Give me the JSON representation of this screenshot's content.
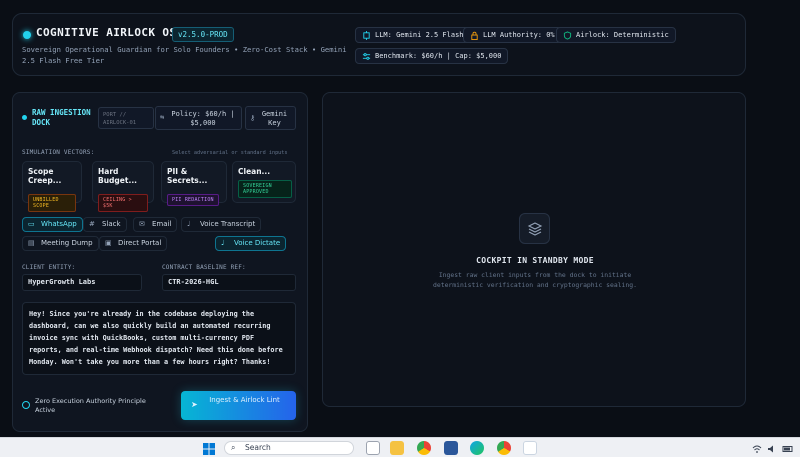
{
  "header": {
    "title": "COGNITIVE AIRLOCK OS",
    "version": "v2.5.0-PROD",
    "subtitle": "Sovereign Operational Guardian for Solo Founders • Zero-Cost Stack • Gemini 2.5 Flash Free Tier",
    "pills": {
      "llm": "LLM: Gemini 2.5 Flash",
      "authority": "LLM Authority: 0%",
      "airlock": "Airlock: Deterministic",
      "benchmark": "Benchmark: $60/h | Cap: $5,000"
    }
  },
  "dock": {
    "title": "RAW INGESTION DOCK",
    "port": "PORT // AIRLOCK-01",
    "policy": "Policy: $60/h | $5,000",
    "gemini_key": "Gemini Key",
    "vectors_label": "SIMULATION VECTORS:",
    "vectors_hint": "Select adversarial or standard inputs",
    "vectors": [
      {
        "title": "Scope Creep...",
        "tag": "UNBILLED SCOPE",
        "color": "#f59e0b"
      },
      {
        "title": "Hard Budget...",
        "tag": "CEILING > $5K",
        "color": "#ef4444"
      },
      {
        "title": "PII & Secrets...",
        "tag": "PII REDACTION",
        "color": "#a855f7"
      },
      {
        "title": "Clean...",
        "tag": "SOVEREIGN APPROVED",
        "color": "#10b981"
      }
    ],
    "channels": {
      "whatsapp": "WhatsApp",
      "slack": "Slack",
      "email": "Email",
      "voice_transcript": "Voice Transcript",
      "meeting_dump": "Meeting Dump",
      "direct_portal": "Direct Portal",
      "voice_dictate": "Voice Dictate"
    },
    "client_label": "CLIENT ENTITY:",
    "client_value": "HyperGrowth Labs",
    "contract_label": "CONTRACT BASELINE REF:",
    "contract_value": "CTR-2026-HGL",
    "message": "Hey! Since you're already in the codebase deploying the dashboard, can we also quickly build an automated recurring invoice sync with QuickBooks, custom multi-currency PDF reports, and real-time Webhook dispatch? Need this done before Monday. Won't take you more than a few hours right? Thanks!",
    "footer_note": "Zero Execution Authority Principle Active",
    "ingest_button": "Ingest & Airlock Lint"
  },
  "cockpit": {
    "title": "COCKPIT IN STANDBY MODE",
    "subtitle": "Ingest raw client inputs from the dock to initiate deterministic verification and cryptographic sealing."
  },
  "taskbar": {
    "search_placeholder": "Search"
  }
}
